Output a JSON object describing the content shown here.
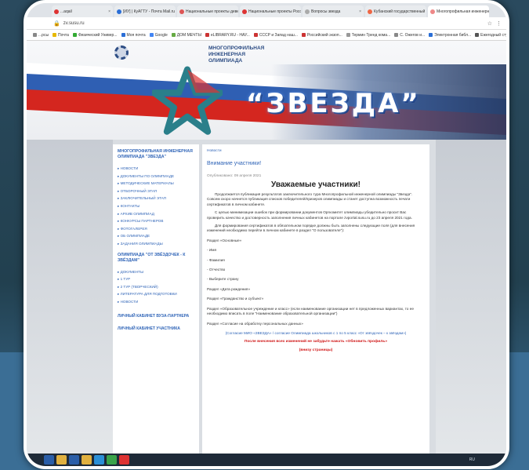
{
  "browser": {
    "tabs": [
      {
        "label": "...aqail",
        "color": "#d33"
      },
      {
        "label": "[ИУ] | КуАГТУ - Почта Mail.ru",
        "color": "#2a6ed6"
      },
      {
        "label": "Национальные проекты девел...",
        "color": "#d55"
      },
      {
        "label": "Национальные проекты России",
        "color": "#d33"
      },
      {
        "label": "Вопросы звезда",
        "color": "#aaa"
      },
      {
        "label": "Кубанский государственный ...",
        "color": "#e64"
      },
      {
        "label": "Многопрофильная инженерная...",
        "color": "#e88",
        "active": true
      }
    ],
    "url": "zv.susu.ru",
    "bookmarks": [
      {
        "label": "...рсы",
        "color": "#888"
      },
      {
        "label": "Почта",
        "color": "#e6b800"
      },
      {
        "label": "Физический Универ...",
        "color": "#3a3"
      },
      {
        "label": "Моя почта",
        "color": "#2a6ed6"
      },
      {
        "label": "Google",
        "color": "#4285f4"
      },
      {
        "label": "ДОМ МЕЧТЫ",
        "color": "#6a4"
      },
      {
        "label": "eLIBRARY.RU - НАУ...",
        "color": "#c33"
      },
      {
        "label": "СССР и Запад наш...",
        "color": "#c33"
      },
      {
        "label": "Российский экзоп...",
        "color": "#c33"
      },
      {
        "label": "Термин Тренд кома...",
        "color": "#999"
      },
      {
        "label": "С. Ожегов и...",
        "color": "#888"
      },
      {
        "label": "Электронная библ...",
        "color": "#2a6ed6"
      },
      {
        "label": "Ежегодный студен...",
        "color": "#555"
      },
      {
        "label": "Всероссийский к...",
        "color": "#6a4"
      }
    ]
  },
  "header": {
    "org_title": "МНОГОПРОФИЛЬНАЯ ИНЖЕНЕРНАЯ ОЛИМПИАДА",
    "brand": "“ЗВЕЗДА”"
  },
  "sidebar": {
    "heading": "МНОГОПРОФИЛЬНАЯ ИНЖЕНЕРНАЯ ОЛИМПИАДА \"ЗВЕЗДА\"",
    "items": [
      "НОВОСТИ",
      "ДОКУМЕНТЫ ПО ОЛИМПИАДЕ",
      "МЕТОДИЧЕСКИЕ МАТЕРИАЛЫ",
      "ОТБОРОЧНЫЙ ЭТАП",
      "ЗАКЛЮЧИТЕЛЬНЫЙ ЭТАП",
      "КОНТАКТЫ",
      "АРХИВ ОЛИМПИАД",
      "КОНКУРСЫ ПАРТНЕРОВ",
      "ФОТОГАЛЕРЕЯ",
      "ОБ ОЛИМПИАДЕ",
      "ЗАДАНИЯ ОЛИМПИАДЫ"
    ],
    "section2_heading": "ОЛИМПИАДА \"ОТ ЗВЁЗДОЧЕК - К ЗВЁЗДАМ\"",
    "section2_items": [
      "ДОКУМЕНТЫ",
      "1 ТУР",
      "2 ТУР (ТВОРЧЕСКИЙ)",
      "ЛИТЕРАТУРА ДЛЯ ПОДГОТОВКИ",
      "НОВОСТИ"
    ],
    "cabinet_partner": "ЛИЧНЫЙ КАБИНЕТ ВУЗА-ПАРТНЕРА",
    "cabinet_participant": "ЛИЧНЫЙ КАБИНЕТ УЧАСТНИКА"
  },
  "content": {
    "breadcrumb": "Новости",
    "title": "Внимание участники!",
    "date": "Опубликовано: 09 апреля 2021",
    "heading": "Уважаемые участники!",
    "p1": "Продолжается публикация результатов заключительного тура Многопрофильной инженерной олимпиады \"Звезда\". Совсем скоро начнется публикация списков победителей/призеров олимпиады и станет доступна возможность печати сертификатов в личном кабинете.",
    "p2": "С целью минимизации ошибок при формировании документов Оргкомитет олимпиады убедительно просит Вас проверить качество и достоверность заполнения личных кабинетов на портале zvportal.susu.ru до 23 апреля 2021 года.",
    "p3": "Для формирования сертификатов в обязательном порядке должны быть заполнены следующие поля (для внесения изменений необходимо перейти в личном кабинете в раздел \"О пользователе\"):",
    "fields": [
      "Раздел «Основные»",
      "- Имя",
      "- Фамилия",
      "- Отчество",
      "- Выберите страну",
      "Раздел «Дата рождения»",
      "Раздел «Гражданство и субъект»",
      "Раздел «Образовательное учреждение и класс» (если наименование организации нет в предложенных вариантах, то ее необходимо вписать в поле \"Наименование образовательной организации\")",
      "Раздел «Согласие на обработку персональных данных»"
    ],
    "consent_link": "(Согласие МИО «ЗВЕЗДА» / согласие Олимпиада школьников с 1 по 5 класс «От звёздочек – к звёздам»)",
    "note": "После внесения всех изменений не забудьте нажать «Обновить профиль»",
    "note2": "(внизу страницы)"
  },
  "taskbar": {
    "icons": [
      {
        "name": "start-icon",
        "color": "#2b5ea8"
      },
      {
        "name": "explorer-icon",
        "color": "#e0b040"
      },
      {
        "name": "word-icon",
        "color": "#2b5ea8"
      },
      {
        "name": "folder-icon",
        "color": "#e0b040"
      },
      {
        "name": "app-icon",
        "color": "#2b8fd6"
      },
      {
        "name": "chrome-icon",
        "color": "#3aa34a"
      },
      {
        "name": "yandex-icon",
        "color": "#d33"
      }
    ],
    "lang": "RU"
  }
}
